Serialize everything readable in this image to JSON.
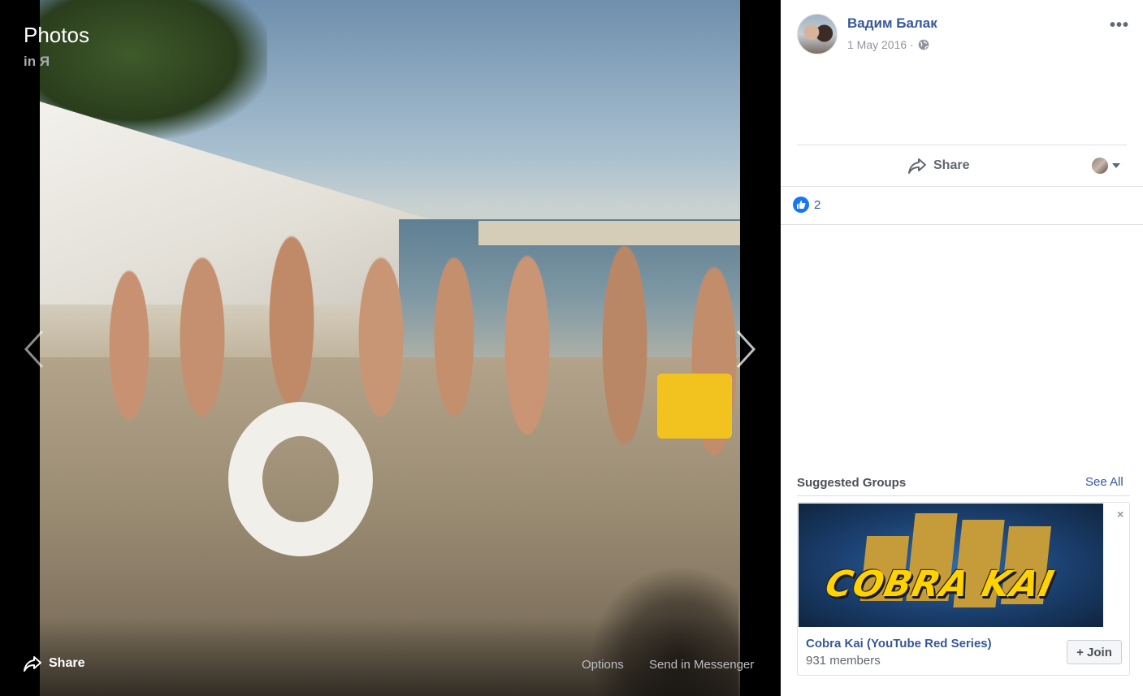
{
  "viewer": {
    "title": "Photos",
    "subtitle": "in Я",
    "share_label": "Share",
    "options_label": "Options",
    "send_label": "Send in Messenger"
  },
  "post": {
    "author": "Вадим Балак",
    "date": "1 May 2016 ·",
    "privacy_icon": "globe-icon",
    "more_label": "•••",
    "share_label": "Share",
    "like_count": "2"
  },
  "suggested_groups": {
    "title": "Suggested Groups",
    "see_all": "See All",
    "group": {
      "logo_text": "COBRA KAI",
      "name": "Cobra Kai (YouTube Red Series)",
      "members": "931 members",
      "join_label": "+ Join",
      "close_label": "×"
    }
  },
  "colors": {
    "link": "#365899",
    "like": "#1877f2",
    "brand_yellow": "#ffd200"
  }
}
